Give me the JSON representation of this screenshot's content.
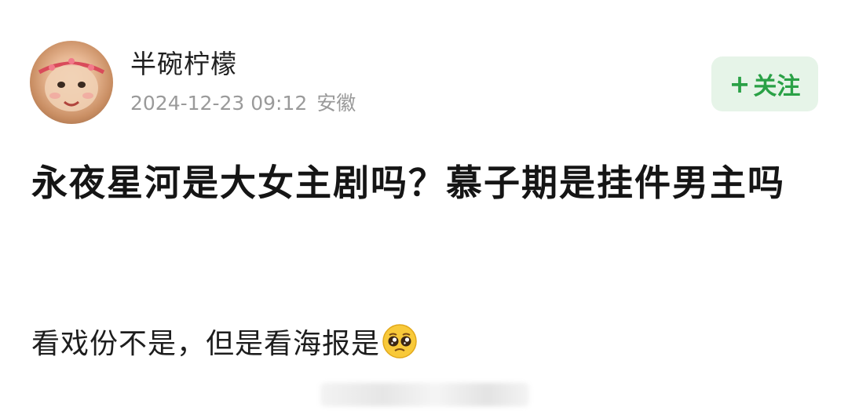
{
  "post": {
    "author": {
      "name": "半碗柠檬",
      "timestamp": "2024-12-23 09:12",
      "location": "安徽"
    },
    "follow_button": {
      "plus": "+",
      "label": "关注"
    },
    "title": "永夜星河是大女主剧吗？慕子期是挂件男主吗",
    "body": "看戏份不是，但是看海报是",
    "emoji": "pleading-face-icon"
  },
  "colors": {
    "accent_green": "#2aa146",
    "follow_bg": "#e6f4e8",
    "meta_gray": "#9a9a9a"
  }
}
